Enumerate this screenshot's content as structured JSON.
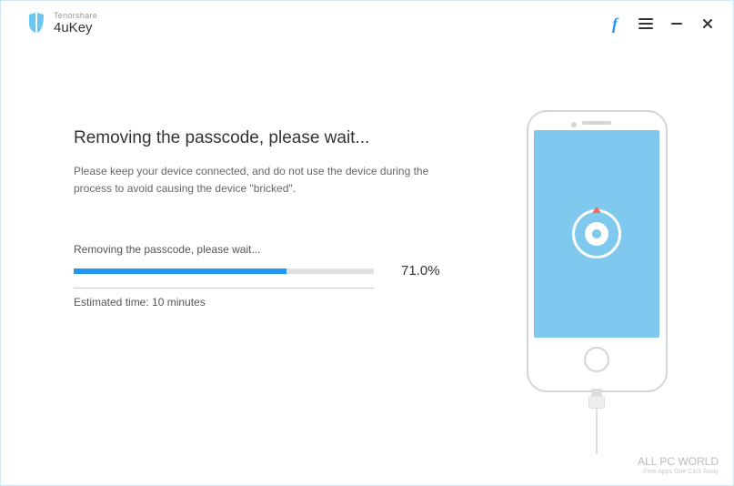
{
  "brand": {
    "company": "Tenorshare",
    "product": "4uKey"
  },
  "main": {
    "heading": "Removing the passcode, please wait...",
    "description": "Please keep your device connected, and do not use the device during the process to avoid causing the device \"bricked\".",
    "progress_label": "Removing the passcode, please wait...",
    "progress_percent": "71.0%",
    "progress_value": 71,
    "eta": "Estimated time: 10 minutes"
  },
  "watermark": {
    "main": "ALL PC WORLD",
    "sub": "Free Apps One Click Away"
  }
}
